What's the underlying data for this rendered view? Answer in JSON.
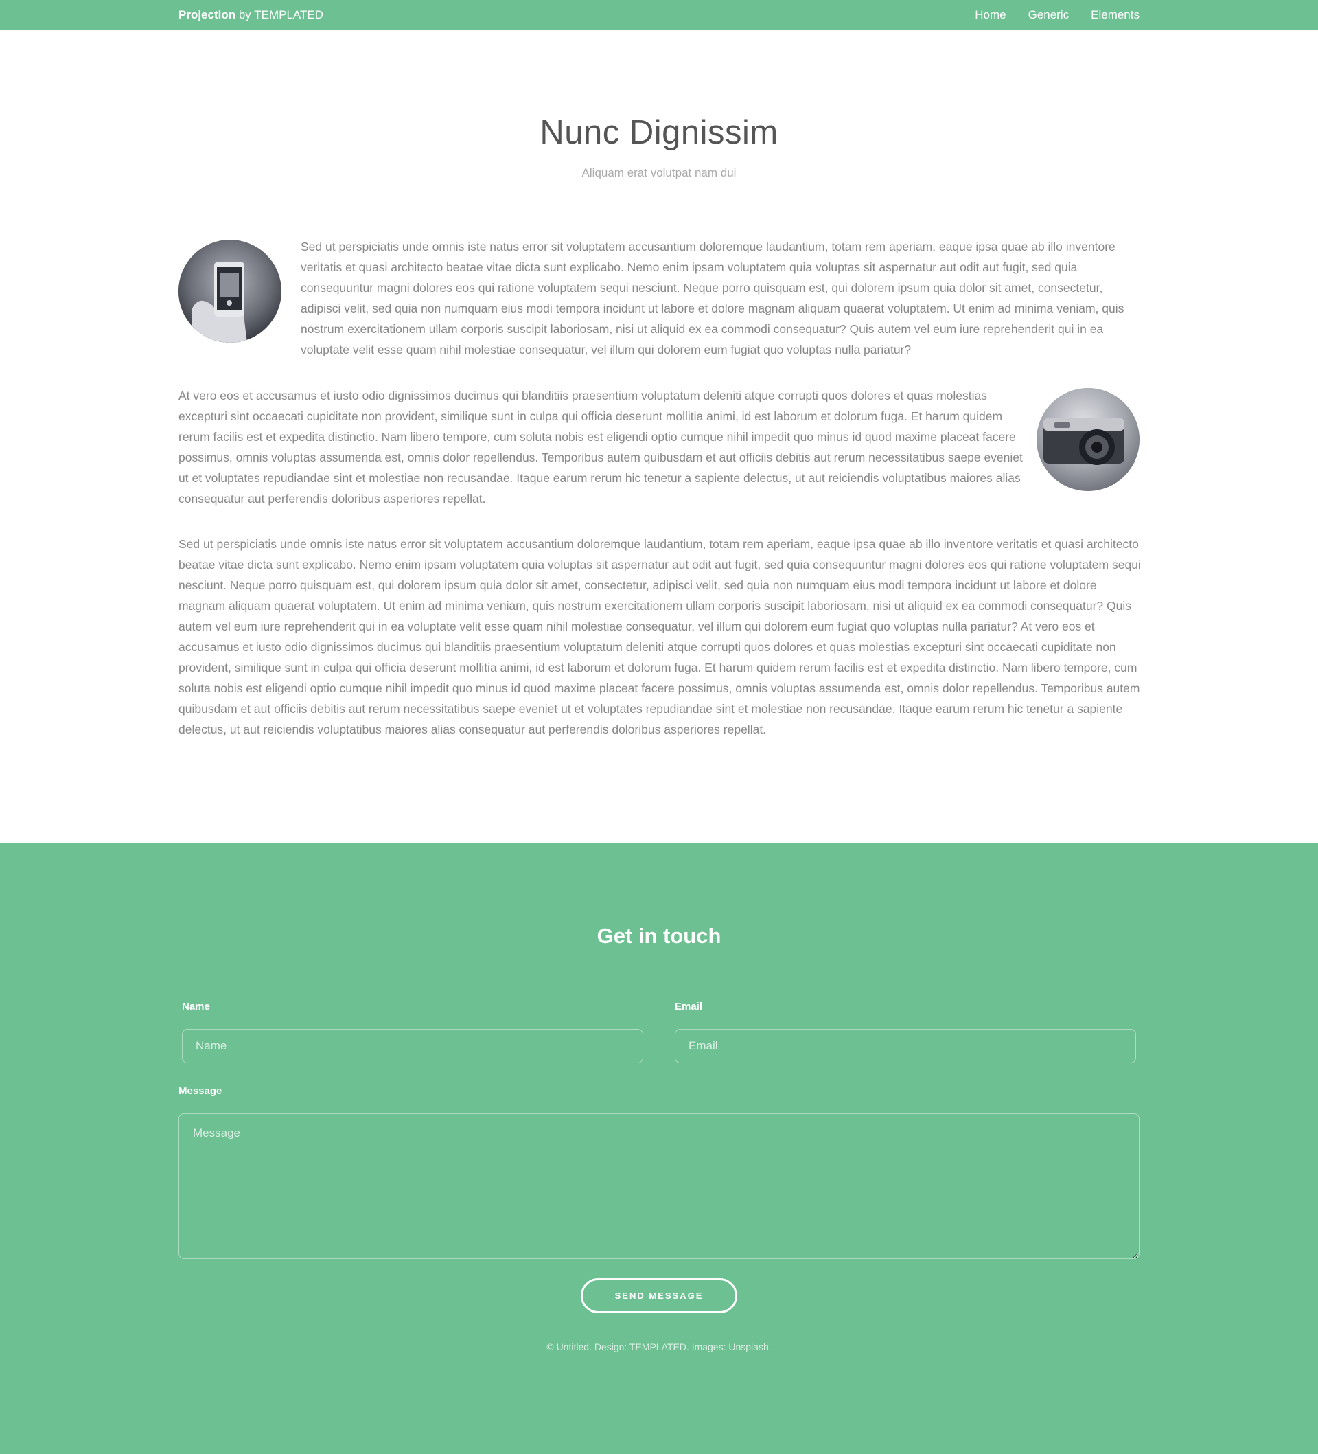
{
  "header": {
    "brand_bold": "Projection",
    "brand_rest": " by TEMPLATED",
    "nav": [
      "Home",
      "Generic",
      "Elements"
    ]
  },
  "main": {
    "title": "Nunc Dignissim",
    "subtitle": "Aliquam erat volutpat nam dui",
    "paragraph_1": "Sed ut perspiciatis unde omnis iste natus error sit voluptatem accusantium doloremque laudantium, totam rem aperiam, eaque ipsa quae ab illo inventore veritatis et quasi architecto beatae vitae dicta sunt explicabo. Nemo enim ipsam voluptatem quia voluptas sit aspernatur aut odit aut fugit, sed quia consequuntur magni dolores eos qui ratione voluptatem sequi nesciunt. Neque porro quisquam est, qui dolorem ipsum quia dolor sit amet, consectetur, adipisci velit, sed quia non numquam eius modi tempora incidunt ut labore et dolore magnam aliquam quaerat voluptatem. Ut enim ad minima veniam, quis nostrum exercitationem ullam corporis suscipit laboriosam, nisi ut aliquid ex ea commodi consequatur? Quis autem vel eum iure reprehenderit qui in ea voluptate velit esse quam nihil molestiae consequatur, vel illum qui dolorem eum fugiat quo voluptas nulla pariatur?",
    "paragraph_2": "At vero eos et accusamus et iusto odio dignissimos ducimus qui blanditiis praesentium voluptatum deleniti atque corrupti quos dolores et quas molestias excepturi sint occaecati cupiditate non provident, similique sunt in culpa qui officia deserunt mollitia animi, id est laborum et dolorum fuga. Et harum quidem rerum facilis est et expedita distinctio. Nam libero tempore, cum soluta nobis est eligendi optio cumque nihil impedit quo minus id quod maxime placeat facere possimus, omnis voluptas assumenda est, omnis dolor repellendus. Temporibus autem quibusdam et aut officiis debitis aut rerum necessitatibus saepe eveniet ut et voluptates repudiandae sint et molestiae non recusandae. Itaque earum rerum hic tenetur a sapiente delectus, ut aut reiciendis voluptatibus maiores alias consequatur aut perferendis doloribus asperiores repellat.",
    "paragraph_3": "Sed ut perspiciatis unde omnis iste natus error sit voluptatem accusantium doloremque laudantium, totam rem aperiam, eaque ipsa quae ab illo inventore veritatis et quasi architecto beatae vitae dicta sunt explicabo. Nemo enim ipsam voluptatem quia voluptas sit aspernatur aut odit aut fugit, sed quia consequuntur magni dolores eos qui ratione voluptatem sequi nesciunt. Neque porro quisquam est, qui dolorem ipsum quia dolor sit amet, consectetur, adipisci velit, sed quia non numquam eius modi tempora incidunt ut labore et dolore magnam aliquam quaerat voluptatem. Ut enim ad minima veniam, quis nostrum exercitationem ullam corporis suscipit laboriosam, nisi ut aliquid ex ea commodi consequatur? Quis autem vel eum iure reprehenderit qui in ea voluptate velit esse quam nihil molestiae consequatur, vel illum qui dolorem eum fugiat quo voluptas nulla pariatur? At vero eos et accusamus et iusto odio dignissimos ducimus qui blanditiis praesentium voluptatum deleniti atque corrupti quos dolores et quas molestias excepturi sint occaecati cupiditate non provident, similique sunt in culpa qui officia deserunt mollitia animi, id est laborum et dolorum fuga. Et harum quidem rerum facilis est et expedita distinctio. Nam libero tempore, cum soluta nobis est eligendi optio cumque nihil impedit quo minus id quod maxime placeat facere possimus, omnis voluptas assumenda est, omnis dolor repellendus. Temporibus autem quibusdam et aut officiis debitis aut rerum necessitatibus saepe eveniet ut et voluptates repudiandae sint et molestiae non recusandae. Itaque earum rerum hic tenetur a sapiente delectus, ut aut reiciendis voluptatibus maiores alias consequatur aut perferendis doloribus asperiores repellat."
  },
  "images": {
    "image_1": "phone-photo-icon",
    "image_2": "camera-photo-icon"
  },
  "contact": {
    "title": "Get in touch",
    "name_label": "Name",
    "name_placeholder": "Name",
    "email_label": "Email",
    "email_placeholder": "Email",
    "message_label": "Message",
    "message_placeholder": "Message",
    "send_label": "SEND MESSAGE"
  },
  "footer": {
    "copyright": "© Untitled. Design: TEMPLATED. Images: Unsplash."
  },
  "colors": {
    "accent": "#6cc091",
    "text": "#888888",
    "heading": "#555555"
  }
}
